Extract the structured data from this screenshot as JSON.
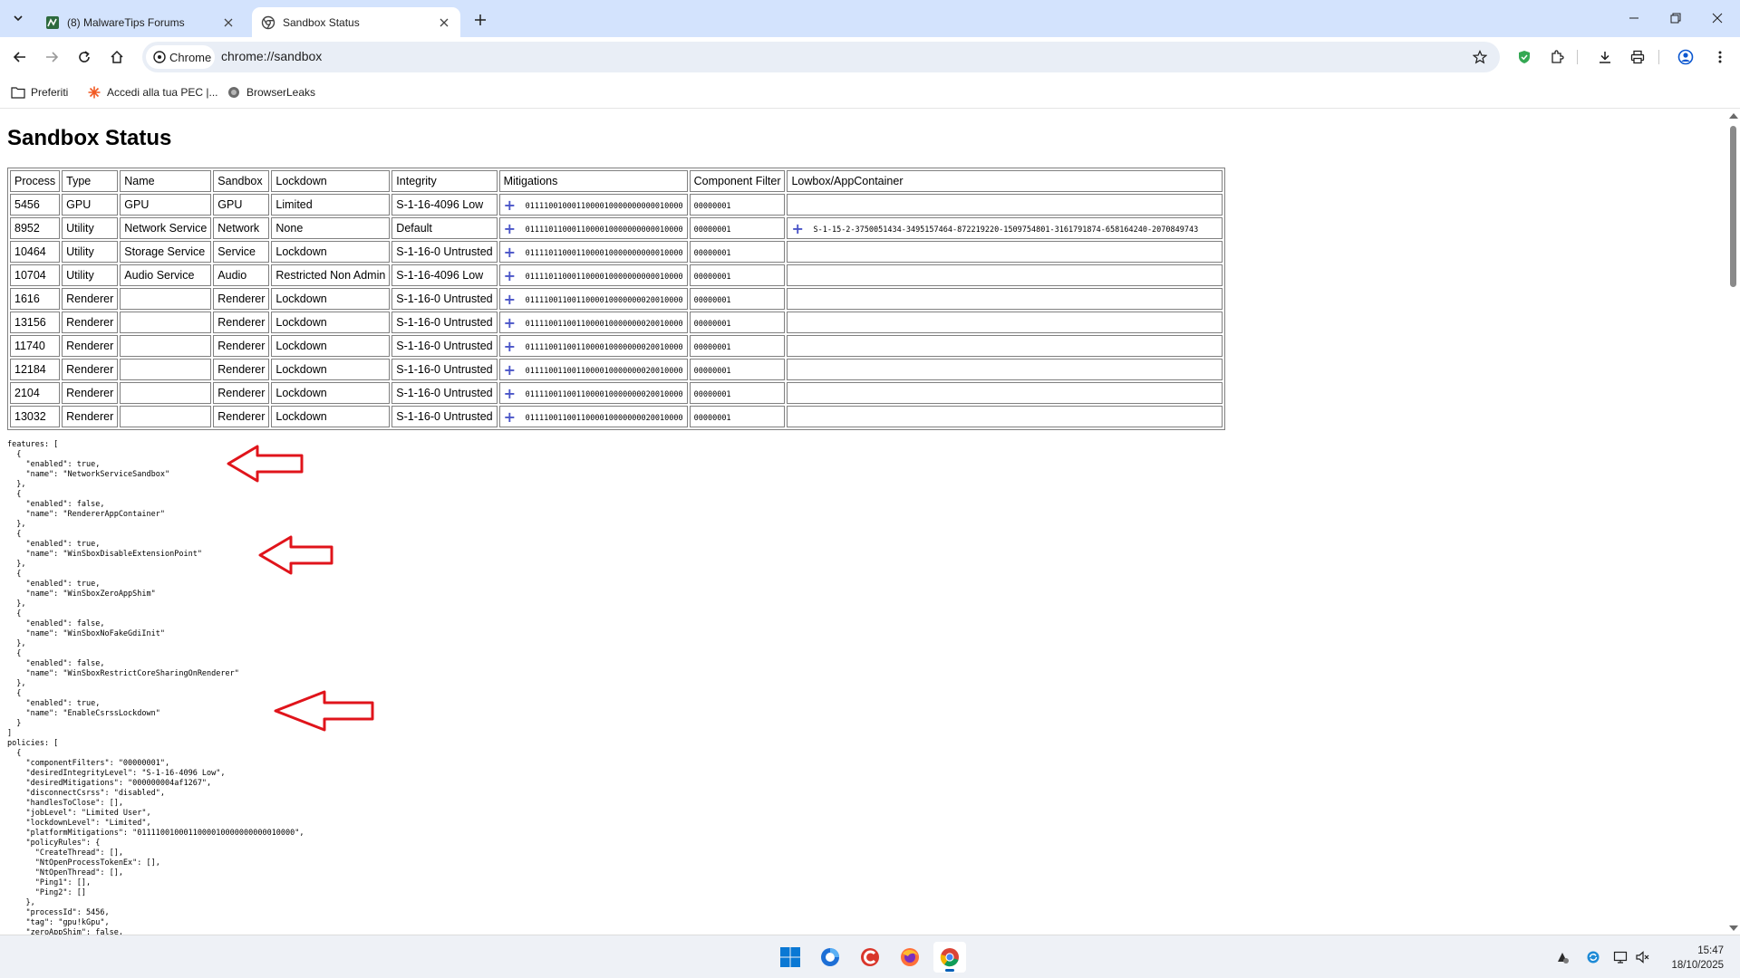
{
  "tabs": [
    {
      "title": "(8) MalwareTips Forums",
      "active": false
    },
    {
      "title": "Sandbox Status",
      "active": true
    }
  ],
  "omnibox": {
    "chip_label": "Chrome",
    "url": "chrome://sandbox"
  },
  "bookmarks": [
    {
      "label": "Preferiti",
      "icon": "folder-icon"
    },
    {
      "label": "Accedi alla tua PEC |...",
      "icon": "pec-icon"
    },
    {
      "label": "BrowserLeaks",
      "icon": "browserleaks-icon"
    }
  ],
  "page": {
    "title": "Sandbox Status",
    "table": {
      "headers": [
        "Process",
        "Type",
        "Name",
        "Sandbox",
        "Lockdown",
        "Integrity",
        "Mitigations",
        "Component Filter",
        "Lowbox/AppContainer"
      ],
      "rows": [
        {
          "process": "5456",
          "type": "GPU",
          "name": "GPU",
          "sandbox": "GPU",
          "lockdown": "Limited",
          "integrity": "S-1-16-4096 Low",
          "mitigations": "0111100100011000010000000000010000",
          "component_filter": "00000001",
          "lowbox": ""
        },
        {
          "process": "8952",
          "type": "Utility",
          "name": "Network Service",
          "sandbox": "Network",
          "lockdown": "None",
          "integrity": "Default",
          "mitigations": "0111101100011000010000000000010000",
          "component_filter": "00000001",
          "lowbox": "S-1-15-2-3750051434-3495157464-872219220-1509754801-3161791874-658164240-2070849743"
        },
        {
          "process": "10464",
          "type": "Utility",
          "name": "Storage Service",
          "sandbox": "Service",
          "lockdown": "Lockdown",
          "integrity": "S-1-16-0 Untrusted",
          "mitigations": "0111101100011000010000000000010000",
          "component_filter": "00000001",
          "lowbox": ""
        },
        {
          "process": "10704",
          "type": "Utility",
          "name": "Audio Service",
          "sandbox": "Audio",
          "lockdown": "Restricted Non Admin",
          "integrity": "S-1-16-4096 Low",
          "mitigations": "0111101100011000010000000000010000",
          "component_filter": "00000001",
          "lowbox": ""
        },
        {
          "process": "1616",
          "type": "Renderer",
          "name": "",
          "sandbox": "Renderer",
          "lockdown": "Lockdown",
          "integrity": "S-1-16-0 Untrusted",
          "mitigations": "0111100110011000010000000020010000",
          "component_filter": "00000001",
          "lowbox": ""
        },
        {
          "process": "13156",
          "type": "Renderer",
          "name": "",
          "sandbox": "Renderer",
          "lockdown": "Lockdown",
          "integrity": "S-1-16-0 Untrusted",
          "mitigations": "0111100110011000010000000020010000",
          "component_filter": "00000001",
          "lowbox": ""
        },
        {
          "process": "11740",
          "type": "Renderer",
          "name": "",
          "sandbox": "Renderer",
          "lockdown": "Lockdown",
          "integrity": "S-1-16-0 Untrusted",
          "mitigations": "0111100110011000010000000020010000",
          "component_filter": "00000001",
          "lowbox": ""
        },
        {
          "process": "12184",
          "type": "Renderer",
          "name": "",
          "sandbox": "Renderer",
          "lockdown": "Lockdown",
          "integrity": "S-1-16-0 Untrusted",
          "mitigations": "0111100110011000010000000020010000",
          "component_filter": "00000001",
          "lowbox": ""
        },
        {
          "process": "2104",
          "type": "Renderer",
          "name": "",
          "sandbox": "Renderer",
          "lockdown": "Lockdown",
          "integrity": "S-1-16-0 Untrusted",
          "mitigations": "0111100110011000010000000020010000",
          "component_filter": "00000001",
          "lowbox": ""
        },
        {
          "process": "13032",
          "type": "Renderer",
          "name": "",
          "sandbox": "Renderer",
          "lockdown": "Lockdown",
          "integrity": "S-1-16-0 Untrusted",
          "mitigations": "0111100110011000010000000020010000",
          "component_filter": "00000001",
          "lowbox": ""
        }
      ]
    },
    "json_dump": "features: [\n  {\n    \"enabled\": true,\n    \"name\": \"NetworkServiceSandbox\"\n  },\n  {\n    \"enabled\": false,\n    \"name\": \"RendererAppContainer\"\n  },\n  {\n    \"enabled\": true,\n    \"name\": \"WinSboxDisableExtensionPoint\"\n  },\n  {\n    \"enabled\": true,\n    \"name\": \"WinSboxZeroAppShim\"\n  },\n  {\n    \"enabled\": false,\n    \"name\": \"WinSboxNoFakeGdiInit\"\n  },\n  {\n    \"enabled\": false,\n    \"name\": \"WinSboxRestrictCoreSharingOnRenderer\"\n  },\n  {\n    \"enabled\": true,\n    \"name\": \"EnableCsrssLockdown\"\n  }\n]\npolicies: [\n  {\n    \"componentFilters\": \"00000001\",\n    \"desiredIntegrityLevel\": \"S-1-16-4096 Low\",\n    \"desiredMitigations\": \"000000004af1267\",\n    \"disconnectCsrss\": \"disabled\",\n    \"handlesToClose\": [],\n    \"jobLevel\": \"Limited User\",\n    \"lockdownLevel\": \"Limited\",\n    \"platformMitigations\": \"0111100100011000010000000000010000\",\n    \"policyRules\": {\n      \"CreateThread\": [],\n      \"NtOpenProcessTokenEx\": [],\n      \"NtOpenThread\": [],\n      \"Ping1\": [],\n      \"Ping2\": []\n    },\n    \"processId\": 5456,\n    \"tag\": \"gpu!kGpu\",\n    \"zeroAppShim\": false,"
  },
  "taskbar": {
    "time": "15:47",
    "date": "18/10/2025"
  },
  "colors": {
    "tabstrip": "#d3e3fd",
    "annotation_arrow": "#e0141b",
    "plus": "#4a55c8"
  }
}
